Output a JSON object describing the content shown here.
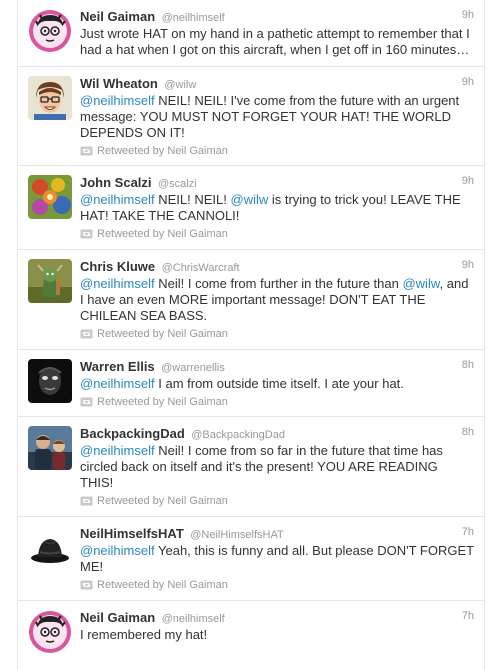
{
  "retweet_prefix": "Retweeted by Neil Gaiman",
  "tweets": [
    {
      "name": "Neil Gaiman",
      "handle": "@neilhimself",
      "time": "9h",
      "text": "Just wrote HAT on my hand in a pathetic attempt to remember that I had a hat when I got on this aircraft, when I get off in 160 minutes…"
    },
    {
      "name": "Wil Wheaton",
      "handle": "@wilw",
      "time": "9h",
      "mention1": "@neilhimself",
      "text": " NEIL! NEIL! I've come from the future with an urgent message: YOU MUST NOT FORGET YOUR HAT! THE WORLD DEPENDS ON IT!",
      "retweet": "Retweeted by Neil Gaiman"
    },
    {
      "name": "John Scalzi",
      "handle": "@scalzi",
      "time": "9h",
      "mention1": "@neilhimself",
      "text_a": " NEIL! NEIL! ",
      "mention2": "@wilw",
      "text_b": " is trying to trick you! LEAVE THE HAT! TAKE THE CANNOLI!",
      "retweet": "Retweeted by Neil Gaiman"
    },
    {
      "name": "Chris Kluwe",
      "handle": "@ChrisWarcraft",
      "time": "9h",
      "mention1": "@neilhimself",
      "text_a": " Neil! I come from further in the future than ",
      "mention2": "@wilw",
      "text_b": ", and I have an even MORE important message! DON'T EAT THE CHILEAN SEA BASS.",
      "retweet": "Retweeted by Neil Gaiman"
    },
    {
      "name": "Warren Ellis",
      "handle": "@warrenellis",
      "time": "8h",
      "mention1": "@neilhimself",
      "text": " I am from outside time itself. I ate your hat.",
      "retweet": "Retweeted by Neil Gaiman"
    },
    {
      "name": "BackpackingDad",
      "handle": "@BackpackingDad",
      "time": "8h",
      "mention1": "@neilhimself",
      "text": " Neil! I come from so far in the future that time has circled back on itself and it's the present! YOU ARE READING THIS!",
      "retweet": "Retweeted by Neil Gaiman"
    },
    {
      "name": "NeilHimselfsHAT",
      "handle": "@NeilHimselfsHAT",
      "time": "7h",
      "mention1": "@neilhimself",
      "text": " Yeah, this is funny and all. But please DON'T FORGET ME!",
      "retweet": "Retweeted by Neil Gaiman"
    },
    {
      "name": "Neil Gaiman",
      "handle": "@neilhimself",
      "time": "7h",
      "text": "I remembered my hat!"
    }
  ]
}
